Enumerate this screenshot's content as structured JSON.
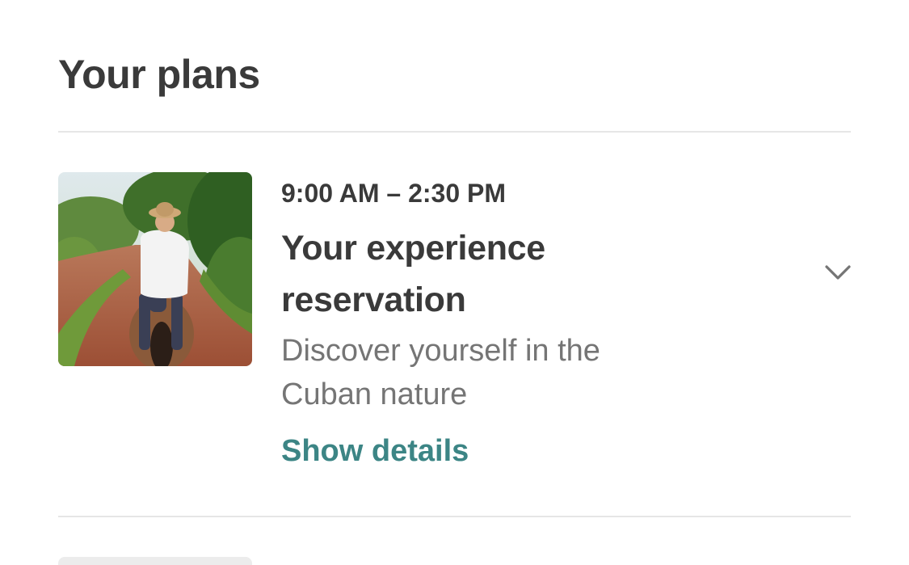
{
  "header": {
    "title": "Your plans"
  },
  "plans": [
    {
      "time": "9:00 AM – 2:30 PM",
      "title": "Your experience reservation",
      "subtitle": "Discover yourself in the Cuban nature",
      "link_label": "Show details",
      "image": "horse-rider-on-dirt-trail-photo",
      "expand_icon": "chevron-down-icon"
    }
  ],
  "colors": {
    "text_primary": "#3a3a3a",
    "text_secondary": "#757575",
    "link": "#3c8585",
    "divider": "#e6e6e6",
    "background": "#ffffff"
  }
}
